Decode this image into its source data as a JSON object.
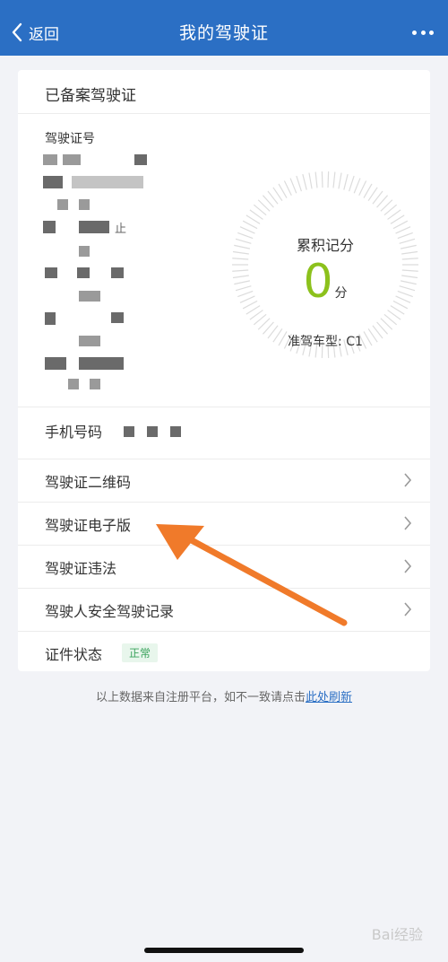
{
  "nav": {
    "back_label": "返回",
    "title": "我的驾驶证"
  },
  "license_card": {
    "section_title": "已备案驾驶证",
    "license_number_label": "驾驶证号",
    "ghost_text_1": "止",
    "score_title": "累积记分",
    "score_value": "0",
    "score_unit": "分",
    "vehicle_type": "准驾车型: C1",
    "phone_label": "手机号码"
  },
  "menu": {
    "items": [
      {
        "label": "驾驶证二维码"
      },
      {
        "label": "驾驶证电子版"
      },
      {
        "label": "驾驶证违法"
      },
      {
        "label": "驾驶人安全驾驶记录"
      }
    ],
    "status_label": "证件状态",
    "status_value": "正常"
  },
  "footer": {
    "note": "以上数据来自注册平台，如不一致请点击",
    "refresh_link": "此处刷新"
  },
  "watermark": {
    "text": "Bai经验"
  },
  "colors": {
    "nav_bg": "#2b6fc4",
    "score_green": "#8cc11c",
    "arrow_orange": "#f07a2a",
    "status_green": "#3aa35c"
  },
  "icons": [
    "chevron-left-icon",
    "more-dots-icon",
    "chevron-right-icon",
    "score-gauge-ring",
    "annotation-arrow"
  ]
}
